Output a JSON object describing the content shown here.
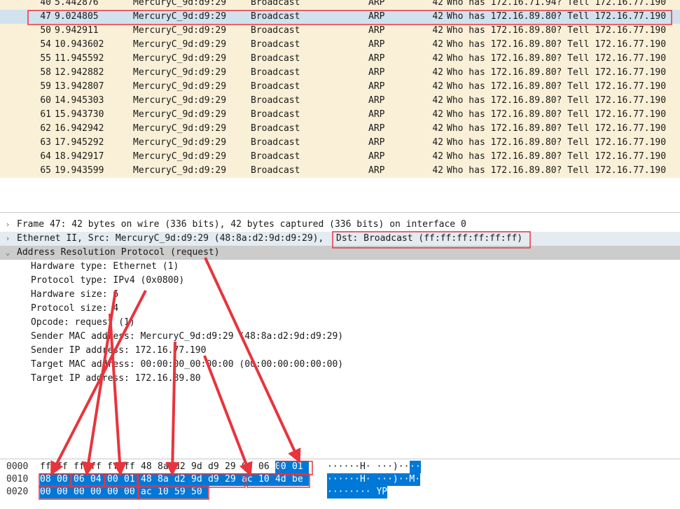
{
  "packets": [
    {
      "no": "40",
      "time": "5.442876",
      "src": "MercuryC_9d:d9:29",
      "dst": "Broadcast",
      "proto": "ARP",
      "len": "42",
      "info": "Who has 172.16.71.94? Tell 172.16.77.190"
    },
    {
      "no": "47",
      "time": "9.024805",
      "src": "MercuryC_9d:d9:29",
      "dst": "Broadcast",
      "proto": "ARP",
      "len": "42",
      "info": "Who has 172.16.89.80? Tell 172.16.77.190",
      "selected": true
    },
    {
      "no": "50",
      "time": "9.942911",
      "src": "MercuryC_9d:d9:29",
      "dst": "Broadcast",
      "proto": "ARP",
      "len": "42",
      "info": "Who has 172.16.89.80? Tell 172.16.77.190"
    },
    {
      "no": "54",
      "time": "10.943602",
      "src": "MercuryC_9d:d9:29",
      "dst": "Broadcast",
      "proto": "ARP",
      "len": "42",
      "info": "Who has 172.16.89.80? Tell 172.16.77.190"
    },
    {
      "no": "55",
      "time": "11.945592",
      "src": "MercuryC_9d:d9:29",
      "dst": "Broadcast",
      "proto": "ARP",
      "len": "42",
      "info": "Who has 172.16.89.80? Tell 172.16.77.190"
    },
    {
      "no": "58",
      "time": "12.942882",
      "src": "MercuryC_9d:d9:29",
      "dst": "Broadcast",
      "proto": "ARP",
      "len": "42",
      "info": "Who has 172.16.89.80? Tell 172.16.77.190"
    },
    {
      "no": "59",
      "time": "13.942807",
      "src": "MercuryC_9d:d9:29",
      "dst": "Broadcast",
      "proto": "ARP",
      "len": "42",
      "info": "Who has 172.16.89.80? Tell 172.16.77.190"
    },
    {
      "no": "60",
      "time": "14.945303",
      "src": "MercuryC_9d:d9:29",
      "dst": "Broadcast",
      "proto": "ARP",
      "len": "42",
      "info": "Who has 172.16.89.80? Tell 172.16.77.190"
    },
    {
      "no": "61",
      "time": "15.943730",
      "src": "MercuryC_9d:d9:29",
      "dst": "Broadcast",
      "proto": "ARP",
      "len": "42",
      "info": "Who has 172.16.89.80? Tell 172.16.77.190"
    },
    {
      "no": "62",
      "time": "16.942942",
      "src": "MercuryC_9d:d9:29",
      "dst": "Broadcast",
      "proto": "ARP",
      "len": "42",
      "info": "Who has 172.16.89.80? Tell 172.16.77.190"
    },
    {
      "no": "63",
      "time": "17.945292",
      "src": "MercuryC_9d:d9:29",
      "dst": "Broadcast",
      "proto": "ARP",
      "len": "42",
      "info": "Who has 172.16.89.80? Tell 172.16.77.190"
    },
    {
      "no": "64",
      "time": "18.942917",
      "src": "MercuryC_9d:d9:29",
      "dst": "Broadcast",
      "proto": "ARP",
      "len": "42",
      "info": "Who has 172.16.89.80? Tell 172.16.77.190"
    },
    {
      "no": "65",
      "time": "19.943599",
      "src": "MercuryC_9d:d9:29",
      "dst": "Broadcast",
      "proto": "ARP",
      "len": "42",
      "info": "Who has 172.16.89.80? Tell 172.16.77.190"
    }
  ],
  "details": {
    "frame": "Frame 47: 42 bytes on wire (336 bits), 42 bytes captured (336 bits) on interface 0",
    "ethernet_src": "Ethernet II, Src: MercuryC_9d:d9:29 (48:8a:d2:9d:d9:29),",
    "ethernet_dst": "Dst: Broadcast (ff:ff:ff:ff:ff:ff)",
    "arp": "Address Resolution Protocol (request)",
    "fields": [
      "Hardware type: Ethernet (1)",
      "Protocol type: IPv4 (0x0800)",
      "Hardware size: 6",
      "Protocol size: 4",
      "Opcode: request (1)",
      "Sender MAC address: MercuryC_9d:d9:29 (48:8a:d2:9d:d9:29)",
      "Sender IP address: 172.16.77.190",
      "Target MAC address: 00:00:00_00:00:00 (00:00:00:00:00:00)",
      "Target IP address: 172.16.89.80"
    ],
    "expander_collapsed": "›",
    "expander_expanded": "⌄"
  },
  "hex": [
    {
      "offset": "0000",
      "bytes": [
        "ff",
        "ff",
        "ff",
        "ff",
        "ff",
        "ff",
        "48",
        "8a",
        "d2",
        "9d",
        "d9",
        "29",
        "08",
        "06",
        "00",
        "01"
      ],
      "sel_from": 14,
      "ascii_plain": "······H· ···)··",
      "ascii_sel": "··"
    },
    {
      "offset": "0010",
      "bytes": [
        "08",
        "00",
        "06",
        "04",
        "00",
        "01",
        "48",
        "8a",
        "d2",
        "9d",
        "d9",
        "29",
        "ac",
        "10",
        "4d",
        "be"
      ],
      "sel_from": 0,
      "ascii_plain": "",
      "ascii_sel": "······H· ···)··M·"
    },
    {
      "offset": "0020",
      "bytes": [
        "00",
        "00",
        "00",
        "00",
        "00",
        "00",
        "ac",
        "10",
        "59",
        "50"
      ],
      "sel_from": 0,
      "ascii_plain": "",
      "ascii_sel": "········ YP"
    }
  ],
  "colors": {
    "row_bg": "#faf0d7",
    "row_selected": "#d1e2ee",
    "hex_selection": "#0078d7",
    "annotation": "#e8343c"
  }
}
